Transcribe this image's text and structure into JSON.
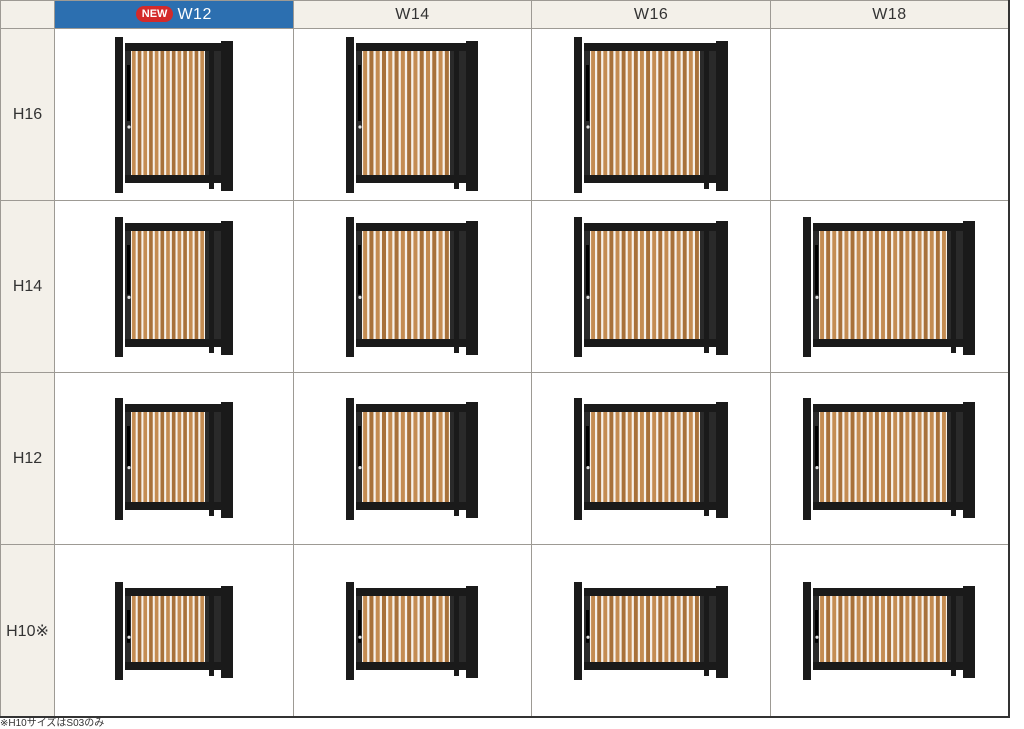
{
  "columns": [
    {
      "label": "W12",
      "badge": "NEW"
    },
    {
      "label": "W14"
    },
    {
      "label": "W16"
    },
    {
      "label": "W18"
    }
  ],
  "rows": [
    {
      "label": "H16",
      "available": [
        true,
        true,
        true,
        false
      ]
    },
    {
      "label": "H14",
      "available": [
        true,
        true,
        true,
        true
      ]
    },
    {
      "label": "H12",
      "available": [
        true,
        true,
        true,
        true
      ]
    },
    {
      "label": "H10※",
      "available": [
        true,
        true,
        true,
        true
      ]
    }
  ],
  "footnote": "※H10サイズはS03のみ",
  "colors": {
    "frame": "#1a1a1a",
    "wood": "#a8713a",
    "wood_light": "#c48c52",
    "header_highlight": "#2c6fb0",
    "badge": "#d42a2a"
  }
}
